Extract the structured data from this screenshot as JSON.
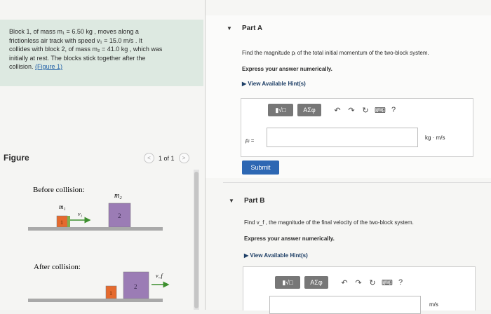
{
  "problem": {
    "line1": "Block 1, of mass m₁ = 6.50 kg , moves along a",
    "line2": "frictionless air track with speed v₁ = 15.0 m/s . It",
    "line3": "collides with block 2, of mass m₂ = 41.0 kg , which was",
    "line4": "initially at rest. The blocks stick together after the",
    "line5_pre": "collision. ",
    "figure_link": "(Figure 1)"
  },
  "figure": {
    "title": "Figure",
    "pager_text": "1 of 1",
    "prev_symbol": "<",
    "next_symbol": ">",
    "before_label": "Before collision:",
    "after_label": "After collision:",
    "m1_label": "m₁",
    "m2_label": "m₂",
    "v1_label": "v₁",
    "vf_label": "v_f",
    "block1_num": "1",
    "block2_num": "2",
    "colors": {
      "block1": "#e56a2e",
      "block2": "#9b7cb5",
      "track": "#a9a9a9",
      "arrow": "#3d8f2e"
    }
  },
  "partA": {
    "label": "Part A",
    "question": "Find the magnitude pᵢ of the total initial momentum of the two-block system.",
    "instruction": "Express your answer numerically.",
    "hint": "View Available Hint(s)",
    "var_label": "pᵢ =",
    "unit": "kg · m/s",
    "submit": "Submit"
  },
  "partB": {
    "label": "Part B",
    "question": "Find v_f , the magnitude of the final velocity of the two-block system.",
    "instruction": "Express your answer numerically.",
    "hint": "View Available Hint(s)",
    "unit": "m/s"
  },
  "toolbar": {
    "templates": "▮√□",
    "greek": "ΑΣφ",
    "undo": "↶",
    "redo": "↷",
    "reset": "↻",
    "keyboard": "⌨",
    "help": "?"
  },
  "icons": [
    "chevron-left-icon",
    "chevron-right-icon",
    "caret-down-icon",
    "triangle-right-icon",
    "undo-icon",
    "redo-icon",
    "reset-icon",
    "keyboard-icon",
    "help-icon"
  ]
}
